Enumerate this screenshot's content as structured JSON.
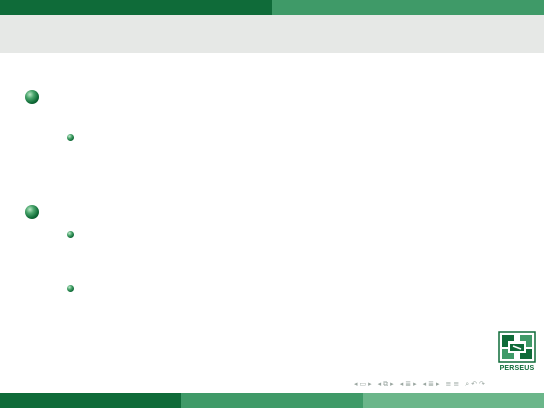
{
  "slide": {
    "items": [
      {
        "level": 1
      },
      {
        "level": 2
      },
      {
        "level": 1
      },
      {
        "level": 2
      },
      {
        "level": 2
      }
    ]
  },
  "logo": {
    "text": "PERSEUS"
  },
  "nav_icons": [
    "nav-prev-arrow-icon",
    "nav-frame-icon",
    "nav-next-arrow-icon",
    "nav-prev-arrow-icon",
    "nav-subsection-icon",
    "nav-next-arrow-icon",
    "nav-prev-arrow-icon",
    "nav-section-icon",
    "nav-next-arrow-icon",
    "nav-prev-arrow-icon",
    "nav-section-icon",
    "nav-next-arrow-icon",
    "nav-align-icon",
    "nav-search-icon",
    "nav-undo-icon"
  ],
  "colors": {
    "dark_green": "#0f6b39",
    "mid_green": "#3f9a68",
    "light_green": "#6bb68a",
    "header_gray": "#e6e8e6"
  }
}
